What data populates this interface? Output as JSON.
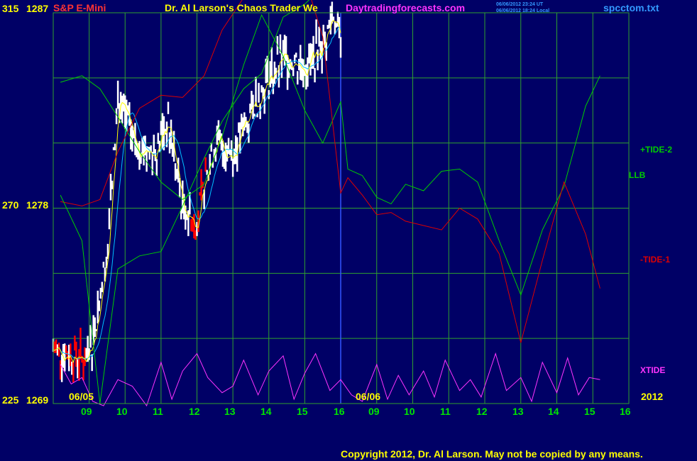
{
  "header": {
    "symbol": "S&P E-Mini",
    "title": "Dr. Al Larson's Chaos Trader We",
    "website": "Daytradingforecasts.com",
    "time_ut": "06/06/2012 23:24 UT",
    "time_local": "06/06/2012 18:24 Local",
    "filename": "spcctom.txt"
  },
  "footer": {
    "copyright": "Copyright 2012, Dr. Al Larson. May not be copied by any means.",
    "year": "2012"
  },
  "colors": {
    "background": "#000066",
    "grid": "#2fa02f",
    "price_up": "#ffffff",
    "price_down": "#ff0000",
    "avg_fast": "#ffff00",
    "avg_slow": "#00c0ff",
    "tide2": "#00cc00",
    "tide1": "#dd0000",
    "xtide": "#ff33ff",
    "axis_text": "#ffff00",
    "hour_text": "#00e600",
    "title_text": "#ffff00",
    "symbol_text": "#ff3333",
    "website_text": "#ff33ff",
    "filename_text": "#3399ff"
  },
  "chart_data": {
    "type": "line",
    "xaxis": {
      "sessions": [
        "06/05",
        "06/06"
      ],
      "hour_ticks": [
        "09",
        "10",
        "11",
        "12",
        "13",
        "14",
        "15",
        "16",
        "09",
        "10",
        "11",
        "12",
        "13",
        "14",
        "15",
        "16"
      ]
    },
    "yaxis": {
      "ticks": [
        {
          "index": "315",
          "price": "1287",
          "value": 1287
        },
        {
          "index": "270",
          "price": "1278",
          "value": 1278
        },
        {
          "index": "225",
          "price": "1269",
          "value": 1269
        }
      ],
      "ylim": [
        1269,
        1287
      ]
    },
    "series": [
      {
        "name": "+TIDE-2",
        "color": "#00cc00",
        "hour": [
          8.2,
          8.8,
          9.3,
          9.8,
          10.4,
          11.0,
          11.6,
          12.2,
          12.7,
          13.3,
          13.8,
          14.4,
          15.0,
          15.5,
          16.0,
          16.2,
          16.6,
          17.0,
          17.4,
          17.8,
          18.3,
          18.8,
          19.3,
          19.8,
          20.4,
          21.0,
          21.6,
          22.2,
          22.8,
          23.2
        ],
        "values": [
          1283.8,
          1284.1,
          1283.5,
          1282.2,
          1280.6,
          1279.2,
          1278.4,
          1279.1,
          1281.3,
          1284.6,
          1286.9,
          1285.0,
          1282.5,
          1281.0,
          1282.9,
          1279.8,
          1279.5,
          1278.5,
          1278.2,
          1279.1,
          1278.8,
          1279.7,
          1279.8,
          1279.2,
          1276.5,
          1274.0,
          1277.0,
          1279.0,
          1282.7,
          1284.1
        ]
      },
      {
        "name": "-TIDE-1",
        "color": "#dd0000",
        "hour": [
          8.2,
          8.8,
          9.3,
          9.8,
          10.4,
          11.0,
          11.6,
          12.2,
          12.7,
          13.3,
          13.8,
          14.4,
          15.0,
          15.5,
          16.0,
          16.2,
          16.6,
          17.0,
          17.4,
          17.8,
          18.3,
          18.8,
          19.3,
          19.8,
          20.4,
          21.0,
          21.6,
          22.2,
          22.8,
          23.2
        ],
        "values": [
          1278.3,
          1278.1,
          1278.4,
          1280.6,
          1282.6,
          1283.2,
          1283.1,
          1284.1,
          1286.2,
          1287.7,
          1288.6,
          1289.2,
          1288.6,
          1285.9,
          1278.7,
          1279.4,
          1278.6,
          1277.7,
          1277.8,
          1277.4,
          1277.2,
          1277.0,
          1278.0,
          1277.5,
          1275.9,
          1271.8,
          1275.6,
          1279.2,
          1276.8,
          1274.3
        ]
      },
      {
        "name": "LLB",
        "color": "#00cc00",
        "hour": [
          8.2,
          8.8,
          9.3,
          9.8,
          10.4,
          11.0,
          11.6,
          12.2,
          12.7,
          13.3,
          13.8,
          14.4,
          15.0,
          15.5,
          16.0
        ],
        "values": [
          1278.6,
          1276.5,
          1269.0,
          1275.2,
          1275.8,
          1276.0,
          1278.1,
          1280.3,
          1282.0,
          1283.5,
          1284.2,
          1286.8,
          1287.4,
          1288.2,
          1287.6
        ]
      },
      {
        "name": "XTIDE",
        "color": "#ff33ff",
        "hour": [
          8.2,
          8.5,
          8.8,
          9.1,
          9.4,
          9.8,
          10.2,
          10.6,
          11.0,
          11.3,
          11.6,
          12.0,
          12.3,
          12.7,
          13.0,
          13.3,
          13.7,
          14.0,
          14.4,
          14.7,
          15.0,
          15.3,
          15.7,
          16.0,
          16.3,
          16.6,
          17.0,
          17.3,
          17.6,
          17.9,
          18.3,
          18.6,
          18.9,
          19.3,
          19.6,
          19.9,
          20.3,
          20.6,
          21.0,
          21.3,
          21.6,
          22.0,
          22.3,
          22.6,
          22.9,
          23.2
        ],
        "values": [
          1270.8,
          1269.9,
          1270.2,
          1269.1,
          1268.9,
          1270.1,
          1269.8,
          1268.9,
          1270.9,
          1269.2,
          1270.5,
          1271.3,
          1270.2,
          1269.5,
          1269.8,
          1271.0,
          1269.4,
          1270.5,
          1271.2,
          1269.2,
          1270.4,
          1271.3,
          1269.6,
          1270.1,
          1269.4,
          1269.1,
          1270.8,
          1269.2,
          1270.3,
          1269.4,
          1270.5,
          1269.3,
          1271.0,
          1269.6,
          1270.1,
          1269.3,
          1271.3,
          1269.6,
          1270.2,
          1269.1,
          1270.9,
          1269.5,
          1271.1,
          1269.4,
          1270.2,
          1270.1
        ]
      }
    ],
    "labels": [
      "+TIDE-2",
      "LLB",
      "-TIDE-1",
      "XTIDE"
    ]
  }
}
